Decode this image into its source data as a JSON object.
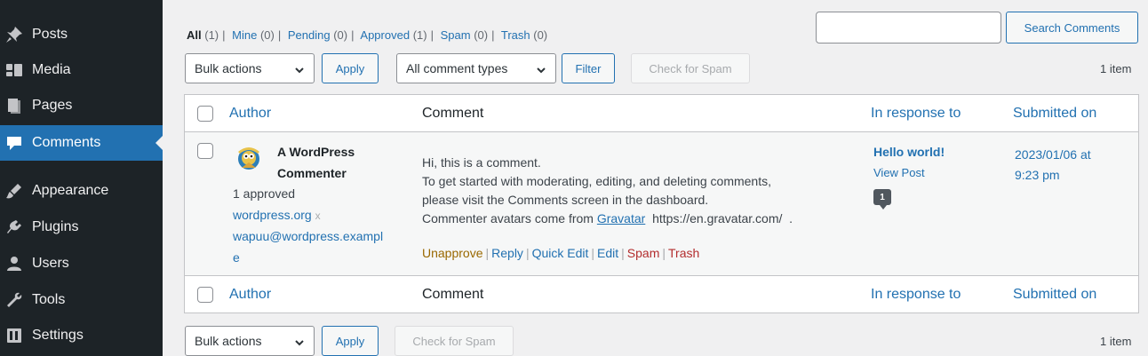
{
  "sidebar": {
    "items": [
      {
        "label": "Posts",
        "icon": "pin-icon"
      },
      {
        "label": "Media",
        "icon": "media-icon"
      },
      {
        "label": "Pages",
        "icon": "pages-icon"
      },
      {
        "label": "Comments",
        "icon": "comment-icon",
        "active": true
      },
      {
        "label": "Appearance",
        "icon": "brush-icon"
      },
      {
        "label": "Plugins",
        "icon": "plug-icon"
      },
      {
        "label": "Users",
        "icon": "user-icon"
      },
      {
        "label": "Tools",
        "icon": "wrench-icon"
      },
      {
        "label": "Settings",
        "icon": "settings-icon"
      }
    ]
  },
  "filters": {
    "all": "All",
    "all_count": "(1)",
    "mine": "Mine",
    "mine_count": "(0)",
    "pending": "Pending",
    "pending_count": "(0)",
    "approved": "Approved",
    "approved_count": "(1)",
    "spam": "Spam",
    "spam_count": "(0)",
    "trash": "Trash",
    "trash_count": "(0)",
    "separator": "|"
  },
  "search": {
    "placeholder": "",
    "button_label": "Search Comments"
  },
  "top_nav": {
    "bulk_actions": "Bulk actions",
    "apply": "Apply",
    "comment_types": "All comment types",
    "filter": "Filter",
    "check_spam": "Check for Spam",
    "item_count": "1 item"
  },
  "table": {
    "columns": {
      "author": "Author",
      "comment": "Comment",
      "response": "In response to",
      "submitted": "Submitted on"
    },
    "row": {
      "author_name_line1": "A WordPress",
      "author_name_line2": "Commenter",
      "approved": "1 approved",
      "url": "wordpress.org",
      "url_x": "x",
      "email_line1": "wapuu@wordpress.exampl",
      "email_line2": "e",
      "comment_line1": "Hi, this is a comment.",
      "comment_line2": "To get started with moderating, editing, and deleting comments,",
      "comment_line3": "please visit the Comments screen in the dashboard.",
      "comment_line4_pre": "Commenter avatars come from ",
      "comment_line4_link": "Gravatar",
      "comment_line4_post": "  https://en.gravatar.com/  .",
      "actions": {
        "unapprove": "Unapprove",
        "reply": "Reply",
        "quick_edit": "Quick Edit",
        "edit": "Edit",
        "spam": "Spam",
        "trash": "Trash",
        "separator": "|"
      },
      "response_title": "Hello world!",
      "view_post": "View Post",
      "comment_count": "1",
      "date_line1": "2023/01/06 at",
      "date_line2": "9:23 pm"
    }
  },
  "bottom_nav": {
    "bulk_actions": "Bulk actions",
    "apply": "Apply",
    "check_spam": "Check for Spam",
    "item_count": "1 item"
  },
  "colors": {
    "sidebar_bg": "#1d2327",
    "active_bg": "#2271b1",
    "link": "#2271b1",
    "unapprove": "#996800",
    "danger": "#b32d2e"
  }
}
